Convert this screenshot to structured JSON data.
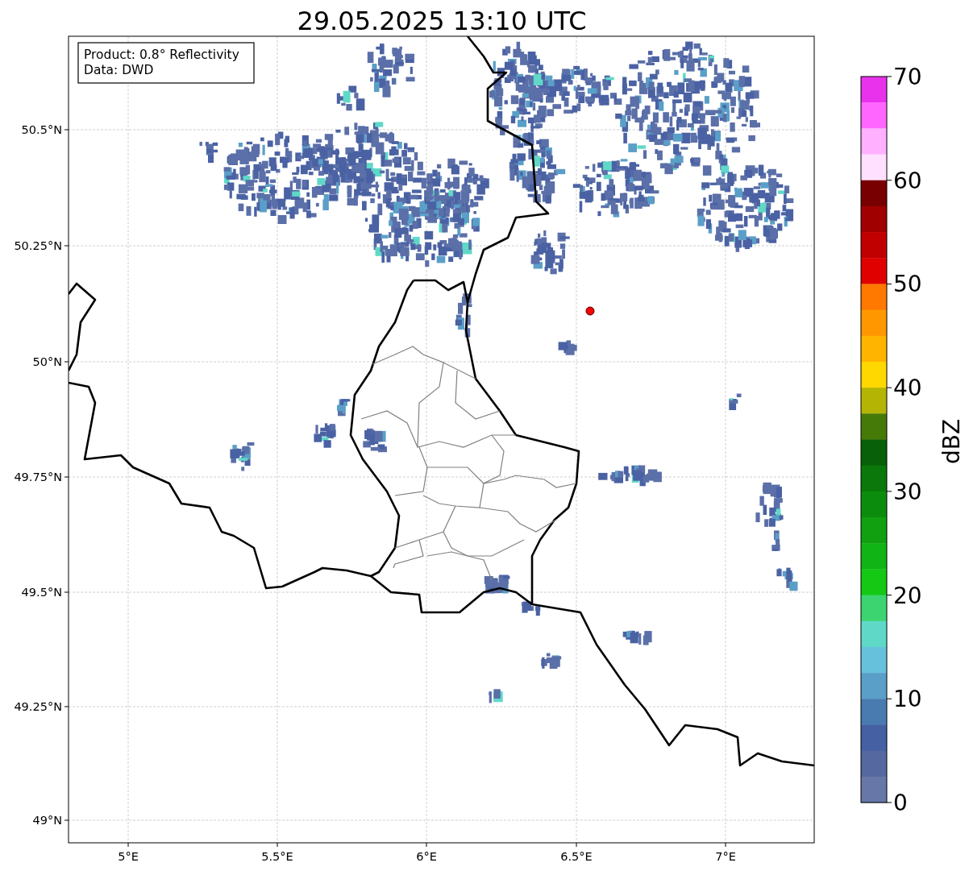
{
  "title": "29.05.2025 13:10 UTC",
  "info_box": {
    "lines": [
      "Product: 0.8° Reflectivity",
      "Data: DWD"
    ]
  },
  "map": {
    "y_labels": [
      "50.5°N",
      "50.25°N",
      "50°N",
      "49.75°N",
      "49.5°N",
      "49.25°N",
      "49°N"
    ],
    "x_labels": [
      "5°E",
      "5.5°E",
      "6°E",
      "6.5°E",
      "7°E"
    ]
  },
  "colorbar": {
    "label": "dBZ",
    "ticks": [
      "70",
      "60",
      "50",
      "40",
      "30",
      "20",
      "10",
      "0"
    ],
    "bins": [
      {
        "color": "#e832ec"
      },
      {
        "color": "#ff66ff"
      },
      {
        "color": "#ffb0ff"
      },
      {
        "color": "#ffe0ff"
      },
      {
        "color": "#780000"
      },
      {
        "color": "#a00000"
      },
      {
        "color": "#c00000"
      },
      {
        "color": "#e00000"
      },
      {
        "color": "#ff7800"
      },
      {
        "color": "#ff9800"
      },
      {
        "color": "#ffb400"
      },
      {
        "color": "#ffd800"
      },
      {
        "color": "#b4b404"
      },
      {
        "color": "#467a08"
      },
      {
        "color": "#086008"
      },
      {
        "color": "#0a780a"
      },
      {
        "color": "#0c8c0c"
      },
      {
        "color": "#10a010"
      },
      {
        "color": "#10b414"
      },
      {
        "color": "#14c814"
      },
      {
        "color": "#3cd470"
      },
      {
        "color": "#60d8c8"
      },
      {
        "color": "#66c2dc"
      },
      {
        "color": "#5a9fc8"
      },
      {
        "color": "#4a7bb0"
      },
      {
        "color": "#4560a3"
      },
      {
        "color": "#55689f"
      },
      {
        "color": "#6677a8"
      }
    ]
  }
}
